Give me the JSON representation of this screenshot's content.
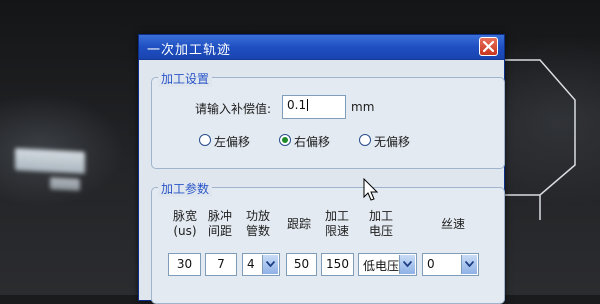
{
  "dialog": {
    "title": "一次加工轨迹"
  },
  "settings_group": {
    "label": "加工设置",
    "offset_label": "请输入补偿值:",
    "offset_value": "0.1",
    "unit": "mm",
    "radios": [
      {
        "label": "左偏移",
        "selected": false
      },
      {
        "label": "右偏移",
        "selected": true
      },
      {
        "label": "无偏移",
        "selected": false
      }
    ]
  },
  "params_group": {
    "label": "加工参数",
    "headers": {
      "pulse_width": "脉宽\n(us)",
      "pulse_interval": "脉冲\n间距",
      "power_tubes": "功放\n管数",
      "tracking": "跟踪",
      "speed_limit": "加工\n限速",
      "voltage": "加工\n电压",
      "wire_speed": "丝速"
    },
    "values": {
      "pulse_width": "30",
      "pulse_interval": "7",
      "power_tubes": "4",
      "tracking": "50",
      "speed_limit": "150",
      "voltage": "低电压",
      "wire_speed": "0"
    }
  },
  "icons": {
    "close": "close-icon",
    "dropdown": "chevron-down-icon",
    "cursor": "mouse-pointer-icon"
  },
  "colors": {
    "titlebar": "#1f4fc2",
    "group_label": "#2a55c8",
    "close": "#c9341f",
    "radio_selected": "#1e8a2a"
  }
}
